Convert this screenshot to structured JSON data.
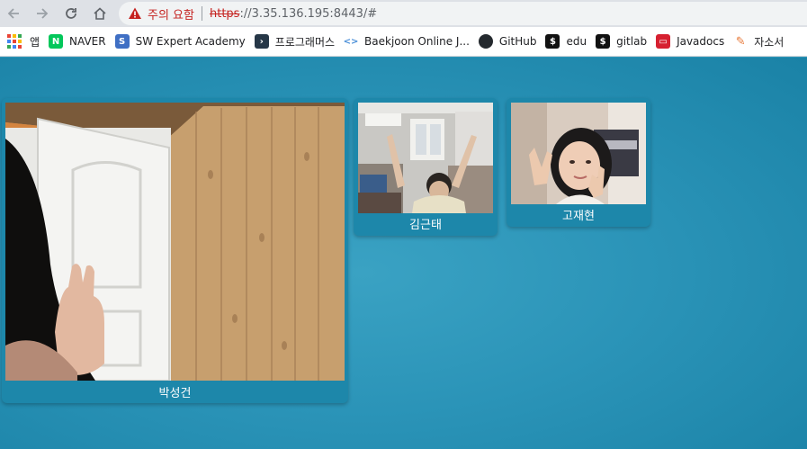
{
  "browser": {
    "security_warning": "주의 요함",
    "url_scheme": "https",
    "url_rest": "://3.35.136.195:8443/#"
  },
  "bookmarks": [
    {
      "label": "앱",
      "icon": "apps-grid-icon"
    },
    {
      "label": "NAVER",
      "icon": "naver-icon",
      "color": "#03c75a",
      "glyph": "N"
    },
    {
      "label": "SW Expert Academy",
      "icon": "swea-icon",
      "color": "#3f6fc4",
      "glyph": "S"
    },
    {
      "label": "프로그래머스",
      "icon": "programmers-icon",
      "color": "#263747",
      "glyph": "›"
    },
    {
      "label": "Baekjoon Online J...",
      "icon": "code-brackets-icon",
      "color": "#4a8fd8",
      "glyph": "<>"
    },
    {
      "label": "GitHub",
      "icon": "github-icon",
      "color": "#24292e",
      "glyph": "●"
    },
    {
      "label": "edu",
      "icon": "edu-icon",
      "color": "#111111",
      "glyph": "$"
    },
    {
      "label": "gitlab",
      "icon": "gitlab-icon",
      "color": "#111111",
      "glyph": "$"
    },
    {
      "label": "Javadocs",
      "icon": "javadocs-icon",
      "color": "#d62030",
      "glyph": "▭"
    },
    {
      "label": "자소서",
      "icon": "pencil-icon",
      "color": "#e87a3a",
      "glyph": "✎"
    }
  ],
  "participants": [
    {
      "name": "박성건"
    },
    {
      "name": "김근태"
    },
    {
      "name": "고재현"
    }
  ],
  "colors": {
    "page_background": "#2b95b8",
    "tile_background": "#1d87aa"
  }
}
